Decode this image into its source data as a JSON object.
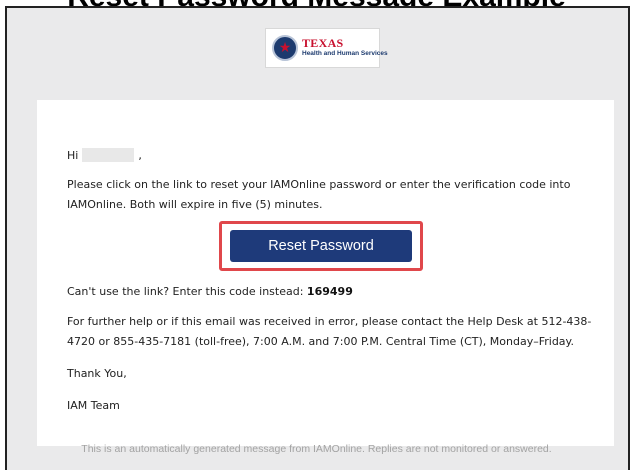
{
  "page_heading": "Reset Password Message Example",
  "logo": {
    "line1": "TEXAS",
    "line2": "Health and Human Services",
    "icon": "texas-seal-icon"
  },
  "email": {
    "greeting_prefix": "Hi",
    "greeting_suffix": ",",
    "intro": "Please click on the link to reset your IAMOnline password or enter the verification code into IAMOnline. Both will expire in five (5) minutes.",
    "button_label": "Reset Password",
    "code_prompt": "Can't use the link? Enter this code instead:",
    "code_value": "169499",
    "help_text": "For further help or if this email was received in error, please contact the Help Desk at 512-438-4720 or 855-435-7181 (toll-free), 7:00 A.M. and 7:00 P.M. Central Time (CT), Monday–Friday.",
    "sign_off": "Thank You,",
    "signature": "IAM Team"
  },
  "footer": "This is an automatically generated message from IAMOnline. Replies are not monitored or answered.",
  "colors": {
    "button": "#1e3a7a",
    "highlight_border": "#e0474b",
    "outer_background": "#eaeaeb"
  }
}
